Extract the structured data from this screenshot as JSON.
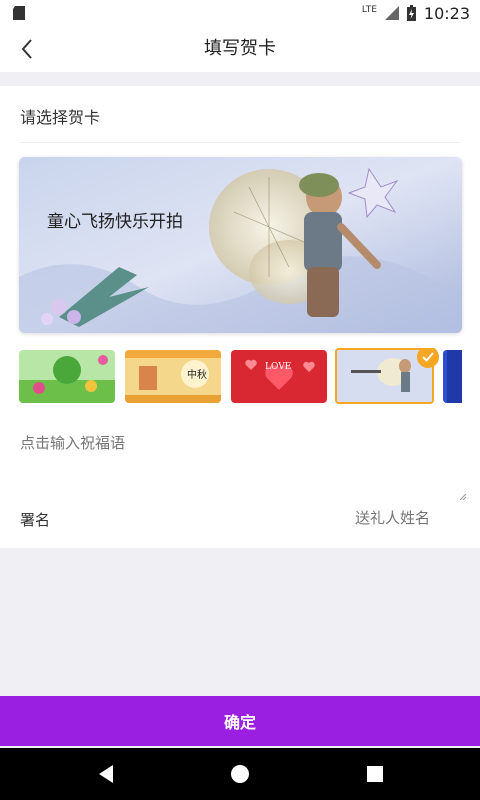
{
  "status_bar": {
    "time": "10:23",
    "network": "LTE"
  },
  "header": {
    "title": "填写贺卡"
  },
  "card_picker": {
    "section_label": "请选择贺卡",
    "hero_caption": "童心飞扬快乐开拍",
    "thumbnails": [
      {
        "theme": "children-cartoon",
        "caption": ""
      },
      {
        "theme": "mid-autumn",
        "caption": "中秋"
      },
      {
        "theme": "love",
        "caption": "LOVE"
      },
      {
        "theme": "fairy-child",
        "caption": ""
      },
      {
        "theme": "blue",
        "caption": ""
      }
    ],
    "selected_index": 3
  },
  "message": {
    "placeholder": "点击输入祝福语"
  },
  "signature": {
    "label": "署名",
    "placeholder": "送礼人姓名"
  },
  "confirm": {
    "label": "确定"
  },
  "colors": {
    "accent": "#9b1fe0",
    "selected_border": "#f5a623"
  }
}
